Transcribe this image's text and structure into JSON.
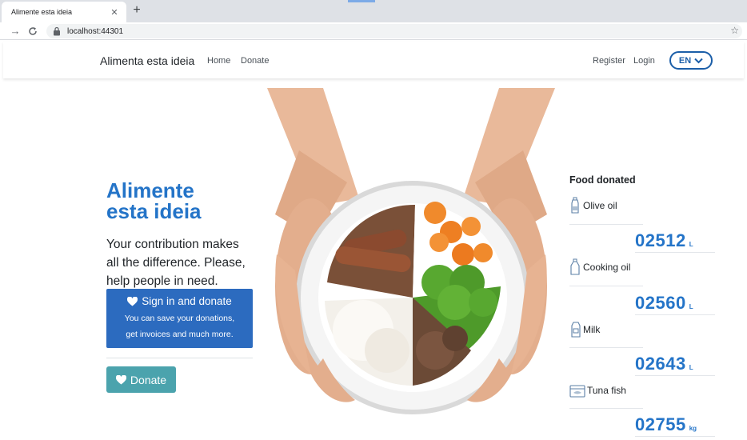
{
  "browser": {
    "tab_title": "Alimente esta ideia",
    "tab_close": "✕",
    "new_tab": "+",
    "url": "localhost:44301",
    "back": "→",
    "reload": "C",
    "bookmark": "☆"
  },
  "navbar": {
    "brand": "Alimenta esta ideia",
    "links": [
      "Home",
      "Donate"
    ],
    "register": "Register",
    "login": "Login",
    "language": "EN"
  },
  "hero": {
    "headline_line1": "Alimente",
    "headline_line2": "esta ideia",
    "lead": "Your contribution makes all the difference. Please, help people in need.",
    "signin_button": {
      "label": "Sign in and donate",
      "sub1": "You can save your donations,",
      "sub2": "get invoices and much more."
    },
    "donate_button": "Donate"
  },
  "stats": {
    "title": "Food donated",
    "items": [
      {
        "label": "Olive oil",
        "value": "02512",
        "unit": "L",
        "icon": "olive-oil-bottle-icon"
      },
      {
        "label": "Cooking oil",
        "value": "02560",
        "unit": "L",
        "icon": "cooking-oil-bottle-icon"
      },
      {
        "label": "Milk",
        "value": "02643",
        "unit": "L",
        "icon": "milk-carton-icon"
      },
      {
        "label": "Tuna fish",
        "value": "02755",
        "unit": "kg",
        "icon": "tuna-can-icon"
      }
    ]
  },
  "colors": {
    "brand_blue": "#2474c8",
    "signin_button": "#2c6bbf",
    "donate_button": "#4ba3ad",
    "language_border": "#1b5ea8"
  }
}
